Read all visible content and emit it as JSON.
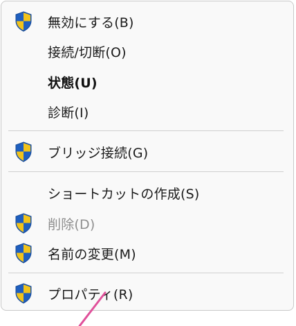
{
  "menu": {
    "items": [
      {
        "label": "無効にする(B)",
        "icon": "uac-shield-icon",
        "bold": false,
        "disabled": false
      },
      {
        "label": "接続/切断(O)",
        "icon": "",
        "bold": false,
        "disabled": false
      },
      {
        "label": "状態(U)",
        "icon": "",
        "bold": true,
        "disabled": false
      },
      {
        "label": "診断(I)",
        "icon": "",
        "bold": false,
        "disabled": false
      },
      {
        "label": "ブリッジ接続(G)",
        "icon": "uac-shield-icon",
        "bold": false,
        "disabled": false
      },
      {
        "label": "ショートカットの作成(S)",
        "icon": "",
        "bold": false,
        "disabled": false
      },
      {
        "label": "削除(D)",
        "icon": "uac-shield-icon",
        "bold": false,
        "disabled": true
      },
      {
        "label": "名前の変更(M)",
        "icon": "uac-shield-icon",
        "bold": false,
        "disabled": false
      },
      {
        "label": "プロパティ(R)",
        "icon": "uac-shield-icon",
        "bold": false,
        "disabled": false
      }
    ]
  },
  "colors": {
    "menu_background": "#f9f9f9",
    "menu_border": "#c8c8c8",
    "text": "#1a1a1a",
    "disabled_text": "#8e8e8e",
    "separator": "#cfcfcf",
    "shield_blue": "#1f5fbf",
    "shield_yellow": "#f2c31a",
    "annotation_pointer": "#e0509a"
  }
}
